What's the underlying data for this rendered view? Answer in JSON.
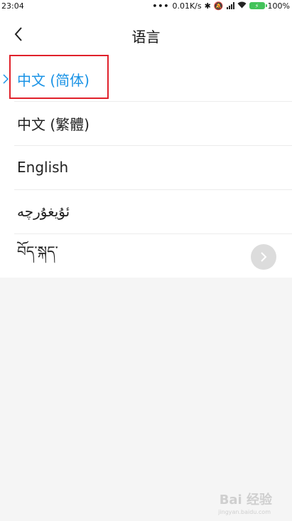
{
  "status_bar": {
    "time": "23:04",
    "speed": "0.01K/s",
    "battery": "100%",
    "icons": [
      "more-dots-icon",
      "bluetooth-icon",
      "mute-icon",
      "signal-icon",
      "wifi-icon",
      "battery-icon"
    ]
  },
  "header": {
    "title": "语言",
    "back_icon": "chevron-left-icon"
  },
  "languages": [
    {
      "label": "中文 (简体)",
      "selected": true
    },
    {
      "label": "中文 (繁體)",
      "selected": false
    },
    {
      "label": "English",
      "selected": false
    },
    {
      "label": "ئۇيغۇرچە",
      "selected": false
    },
    {
      "label": "བོད་སྐད་",
      "selected": false
    }
  ],
  "colors": {
    "accent": "#1a93e6",
    "highlight": "#e0212b",
    "background": "#f5f5f5",
    "battery": "#43c35a"
  },
  "watermark": {
    "text": "Bai 经验",
    "url": "jingyan.baidu.com"
  }
}
